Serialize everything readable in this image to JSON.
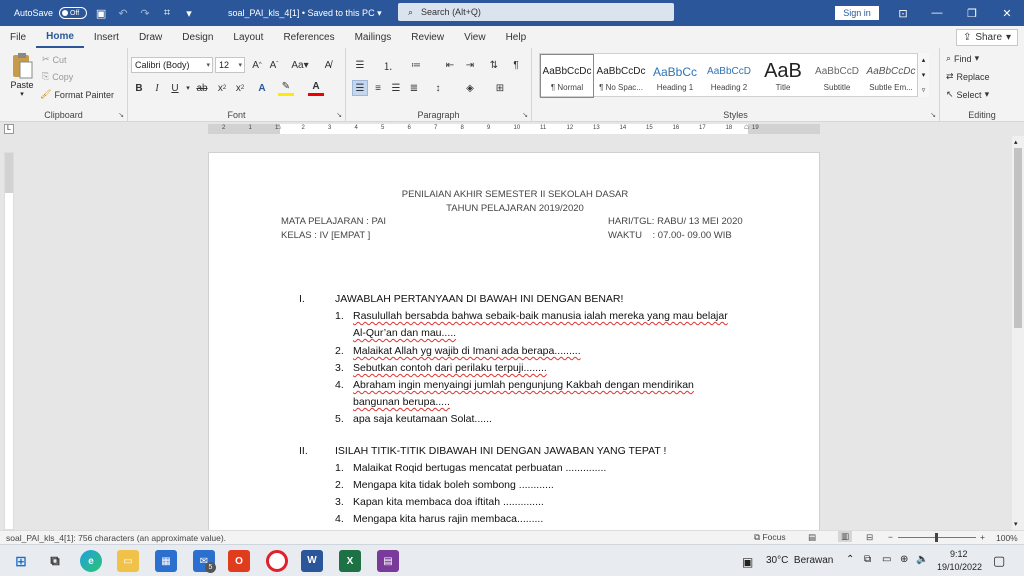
{
  "titlebar": {
    "autosave_label": "AutoSave",
    "autosave_state": "Off",
    "doc_title": "soal_PAI_kls_4[1] • Saved to this PC",
    "search_placeholder": "Search (Alt+Q)",
    "signin_label": "Sign in"
  },
  "menu": {
    "items": [
      "File",
      "Home",
      "Insert",
      "Draw",
      "Design",
      "Layout",
      "References",
      "Mailings",
      "Review",
      "View",
      "Help"
    ],
    "active": "Home",
    "share_label": "Share"
  },
  "ribbon": {
    "clipboard": {
      "paste": "Paste",
      "cut": "Cut",
      "copy": "Copy",
      "format_painter": "Format Painter",
      "label": "Clipboard"
    },
    "font": {
      "name": "Calibri (Body)",
      "size": "12",
      "label": "Font",
      "case_label": "Aa"
    },
    "paragraph": {
      "label": "Paragraph"
    },
    "styles": {
      "label": "Styles",
      "items": [
        {
          "preview": "AaBbCcDc",
          "name": "¶ Normal"
        },
        {
          "preview": "AaBbCcDc",
          "name": "¶ No Spac..."
        },
        {
          "preview": "AaBbCc",
          "name": "Heading 1"
        },
        {
          "preview": "AaBbCcD",
          "name": "Heading 2"
        },
        {
          "preview": "AaB",
          "name": "Title"
        },
        {
          "preview": "AaBbCcD",
          "name": "Subtitle"
        },
        {
          "preview": "AaBbCcDc",
          "name": "Subtle Em..."
        }
      ]
    },
    "editing": {
      "find": "Find",
      "replace": "Replace",
      "select": "Select",
      "label": "Editing"
    }
  },
  "ruler": {
    "marks": [
      "2",
      "1",
      "1",
      "2",
      "3",
      "4",
      "5",
      "6",
      "7",
      "8",
      "9",
      "10",
      "11",
      "12",
      "13",
      "14",
      "15",
      "16",
      "17",
      "18",
      "19"
    ]
  },
  "document": {
    "header1": "PENILAIAN AKHIR SEMESTER II SEKOLAH DASAR",
    "header2": "TAHUN PELAJARAN 2019/2020",
    "mapel": "MATA PELAJARAN : PAI",
    "kelas": "KELAS : IV [EMPAT ]",
    "hari": "HARI/TGL: RABU/ 13 MEI 2020",
    "waktu": "WAKTU    : 07.00- 09.00 WIB",
    "section1": {
      "num": "I.",
      "title": "JAWABLAH PERTANYAAN DI BAWAH INI DENGAN BENAR!",
      "q1_num": "1.",
      "q1_a": "Rasulullah bersabda bahwa sebaik-baik manusia ialah mereka yang mau belajar",
      "q1_b": "Al-Qur’an dan mau.....",
      "q2_num": "2.",
      "q2": "Malaikat Allah yg wajib di Imani ada berapa.........",
      "q3_num": "3.",
      "q3": "Sebutkan contoh dari perilaku terpuji........",
      "q4_num": "4.",
      "q4_a": "Abraham ingin menyaingi jumlah pengunjung Kakbah dengan mendirikan",
      "q4_b": "bangunan berupa.....",
      "q5_num": "5.",
      "q5": "apa saja keutamaan Solat......"
    },
    "section2": {
      "num": "II.",
      "title": "ISILAH TITIK-TITIK DIBAWAH INI DENGAN JAWABAN YANG TEPAT !",
      "q1_num": "1.",
      "q1": "Malaikat Roqid bertugas mencatat perbuatan ..............",
      "q2_num": "2.",
      "q2": "Mengapa kita tidak boleh sombong ............",
      "q3_num": "3.",
      "q3": "Kapan kita membaca doa iftitah ..............",
      "q4_num": "4.",
      "q4": "Mengapa kita harus rajin membaca........."
    }
  },
  "statusbar": {
    "info": "soal_PAI_kls_4[1]: 756 characters (an approximate value).",
    "focus": "Focus",
    "zoom": "100%"
  },
  "taskbar": {
    "weather": "30°C  Berawan",
    "time": "9:12",
    "date": "19/10/2022",
    "mail_badge": "5"
  }
}
